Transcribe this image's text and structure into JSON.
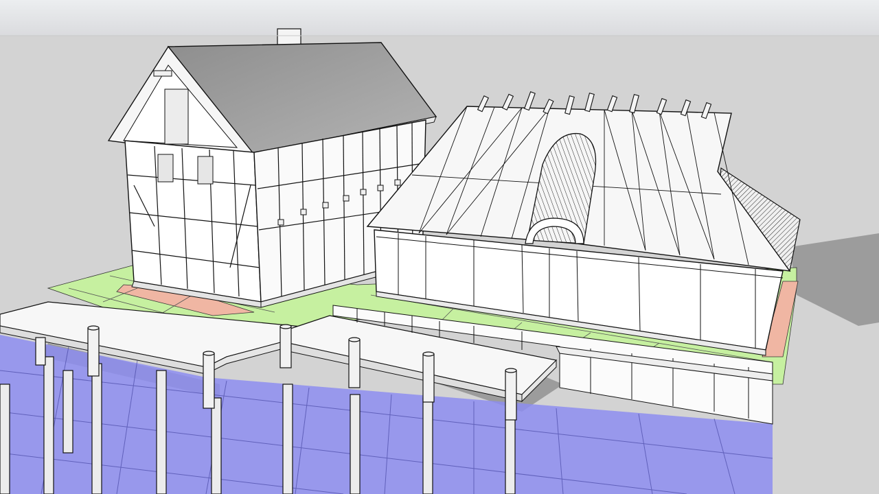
{
  "app": {
    "viewport_label": ""
  },
  "colors": {
    "sky_top": "#e9eaec",
    "sky_bottom": "#dcdde0",
    "ground": "#d3d3d3",
    "wall": "#ffffff",
    "roof_light": "#f4f4f4",
    "roof_shade": "#9c9c9c",
    "edge": "#101010",
    "grass": "#c6f0a0",
    "brick": "#f0b6a3",
    "water": "#8d8df0",
    "shadow": "#7a7a7a"
  },
  "scene": {
    "objects": [
      {
        "name": "timber-frame-house"
      },
      {
        "name": "hall-with-dome"
      },
      {
        "name": "dock-platform"
      },
      {
        "name": "pier-left"
      },
      {
        "name": "pier-center"
      },
      {
        "name": "water-plane"
      },
      {
        "name": "grass-strip"
      }
    ]
  }
}
